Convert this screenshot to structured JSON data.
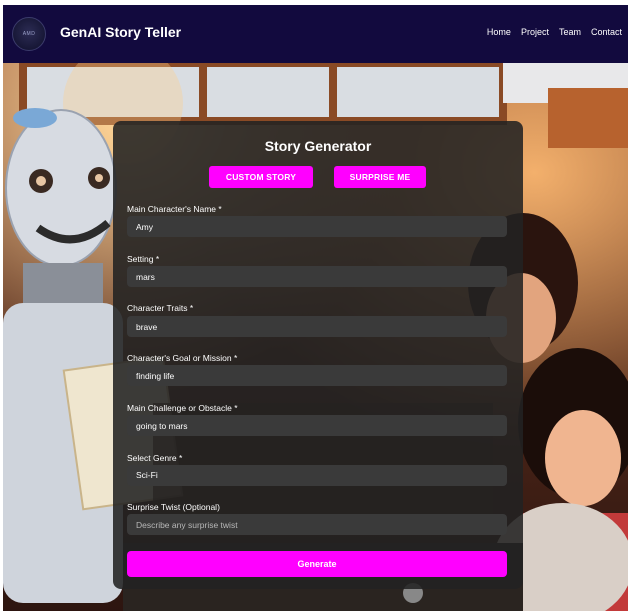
{
  "header": {
    "logo_text": "AMD",
    "brand": "GenAI Story Teller",
    "nav": [
      "Home",
      "Project",
      "Team",
      "Contact"
    ]
  },
  "form": {
    "title": "Story Generator",
    "mode_buttons": {
      "custom": "CUSTOM STORY",
      "surprise": "SURPRISE ME"
    },
    "fields": {
      "name": {
        "label": "Main Character's Name *",
        "value": "Amy",
        "placeholder": ""
      },
      "setting": {
        "label": "Setting *",
        "value": "mars",
        "placeholder": ""
      },
      "traits": {
        "label": "Character Traits *",
        "value": "brave",
        "placeholder": ""
      },
      "goal": {
        "label": "Character's Goal or Mission *",
        "value": "finding life",
        "placeholder": ""
      },
      "challenge": {
        "label": "Main Challenge or Obstacle *",
        "value": "going to mars",
        "placeholder": ""
      },
      "genre": {
        "label": "Select Genre *",
        "value": "Sci-Fi"
      },
      "twist": {
        "label": "Surprise Twist (Optional)",
        "value": "",
        "placeholder": "Describe any surprise twist"
      }
    },
    "submit_label": "Generate"
  },
  "colors": {
    "navbar": "#120a3e",
    "accent": "#ff00ff",
    "card": "#222222",
    "input": "#3a3a3a"
  }
}
